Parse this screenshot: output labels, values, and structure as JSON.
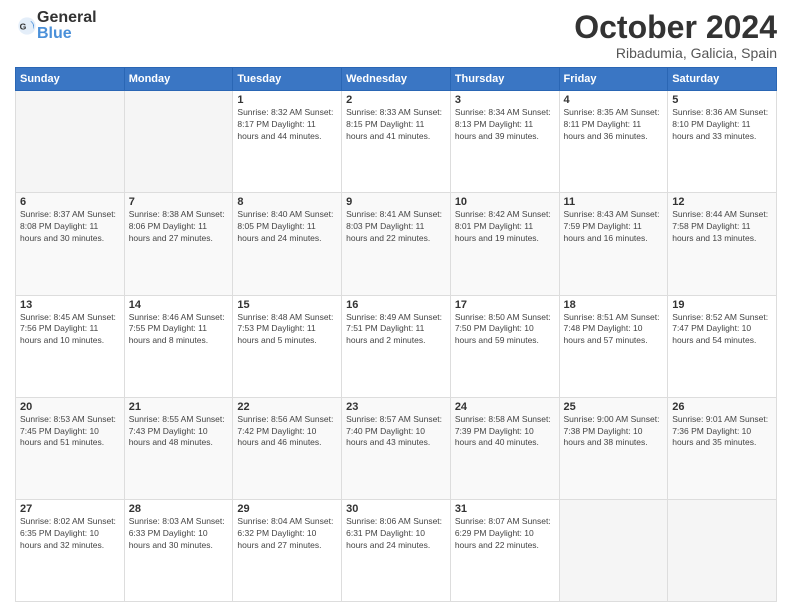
{
  "header": {
    "logo_general": "General",
    "logo_blue": "Blue",
    "month": "October 2024",
    "location": "Ribadumia, Galicia, Spain"
  },
  "weekdays": [
    "Sunday",
    "Monday",
    "Tuesday",
    "Wednesday",
    "Thursday",
    "Friday",
    "Saturday"
  ],
  "weeks": [
    [
      {
        "day": "",
        "info": ""
      },
      {
        "day": "",
        "info": ""
      },
      {
        "day": "1",
        "info": "Sunrise: 8:32 AM\nSunset: 8:17 PM\nDaylight: 11 hours\nand 44 minutes."
      },
      {
        "day": "2",
        "info": "Sunrise: 8:33 AM\nSunset: 8:15 PM\nDaylight: 11 hours\nand 41 minutes."
      },
      {
        "day": "3",
        "info": "Sunrise: 8:34 AM\nSunset: 8:13 PM\nDaylight: 11 hours\nand 39 minutes."
      },
      {
        "day": "4",
        "info": "Sunrise: 8:35 AM\nSunset: 8:11 PM\nDaylight: 11 hours\nand 36 minutes."
      },
      {
        "day": "5",
        "info": "Sunrise: 8:36 AM\nSunset: 8:10 PM\nDaylight: 11 hours\nand 33 minutes."
      }
    ],
    [
      {
        "day": "6",
        "info": "Sunrise: 8:37 AM\nSunset: 8:08 PM\nDaylight: 11 hours\nand 30 minutes."
      },
      {
        "day": "7",
        "info": "Sunrise: 8:38 AM\nSunset: 8:06 PM\nDaylight: 11 hours\nand 27 minutes."
      },
      {
        "day": "8",
        "info": "Sunrise: 8:40 AM\nSunset: 8:05 PM\nDaylight: 11 hours\nand 24 minutes."
      },
      {
        "day": "9",
        "info": "Sunrise: 8:41 AM\nSunset: 8:03 PM\nDaylight: 11 hours\nand 22 minutes."
      },
      {
        "day": "10",
        "info": "Sunrise: 8:42 AM\nSunset: 8:01 PM\nDaylight: 11 hours\nand 19 minutes."
      },
      {
        "day": "11",
        "info": "Sunrise: 8:43 AM\nSunset: 7:59 PM\nDaylight: 11 hours\nand 16 minutes."
      },
      {
        "day": "12",
        "info": "Sunrise: 8:44 AM\nSunset: 7:58 PM\nDaylight: 11 hours\nand 13 minutes."
      }
    ],
    [
      {
        "day": "13",
        "info": "Sunrise: 8:45 AM\nSunset: 7:56 PM\nDaylight: 11 hours\nand 10 minutes."
      },
      {
        "day": "14",
        "info": "Sunrise: 8:46 AM\nSunset: 7:55 PM\nDaylight: 11 hours\nand 8 minutes."
      },
      {
        "day": "15",
        "info": "Sunrise: 8:48 AM\nSunset: 7:53 PM\nDaylight: 11 hours\nand 5 minutes."
      },
      {
        "day": "16",
        "info": "Sunrise: 8:49 AM\nSunset: 7:51 PM\nDaylight: 11 hours\nand 2 minutes."
      },
      {
        "day": "17",
        "info": "Sunrise: 8:50 AM\nSunset: 7:50 PM\nDaylight: 10 hours\nand 59 minutes."
      },
      {
        "day": "18",
        "info": "Sunrise: 8:51 AM\nSunset: 7:48 PM\nDaylight: 10 hours\nand 57 minutes."
      },
      {
        "day": "19",
        "info": "Sunrise: 8:52 AM\nSunset: 7:47 PM\nDaylight: 10 hours\nand 54 minutes."
      }
    ],
    [
      {
        "day": "20",
        "info": "Sunrise: 8:53 AM\nSunset: 7:45 PM\nDaylight: 10 hours\nand 51 minutes."
      },
      {
        "day": "21",
        "info": "Sunrise: 8:55 AM\nSunset: 7:43 PM\nDaylight: 10 hours\nand 48 minutes."
      },
      {
        "day": "22",
        "info": "Sunrise: 8:56 AM\nSunset: 7:42 PM\nDaylight: 10 hours\nand 46 minutes."
      },
      {
        "day": "23",
        "info": "Sunrise: 8:57 AM\nSunset: 7:40 PM\nDaylight: 10 hours\nand 43 minutes."
      },
      {
        "day": "24",
        "info": "Sunrise: 8:58 AM\nSunset: 7:39 PM\nDaylight: 10 hours\nand 40 minutes."
      },
      {
        "day": "25",
        "info": "Sunrise: 9:00 AM\nSunset: 7:38 PM\nDaylight: 10 hours\nand 38 minutes."
      },
      {
        "day": "26",
        "info": "Sunrise: 9:01 AM\nSunset: 7:36 PM\nDaylight: 10 hours\nand 35 minutes."
      }
    ],
    [
      {
        "day": "27",
        "info": "Sunrise: 8:02 AM\nSunset: 6:35 PM\nDaylight: 10 hours\nand 32 minutes."
      },
      {
        "day": "28",
        "info": "Sunrise: 8:03 AM\nSunset: 6:33 PM\nDaylight: 10 hours\nand 30 minutes."
      },
      {
        "day": "29",
        "info": "Sunrise: 8:04 AM\nSunset: 6:32 PM\nDaylight: 10 hours\nand 27 minutes."
      },
      {
        "day": "30",
        "info": "Sunrise: 8:06 AM\nSunset: 6:31 PM\nDaylight: 10 hours\nand 24 minutes."
      },
      {
        "day": "31",
        "info": "Sunrise: 8:07 AM\nSunset: 6:29 PM\nDaylight: 10 hours\nand 22 minutes."
      },
      {
        "day": "",
        "info": ""
      },
      {
        "day": "",
        "info": ""
      }
    ]
  ]
}
